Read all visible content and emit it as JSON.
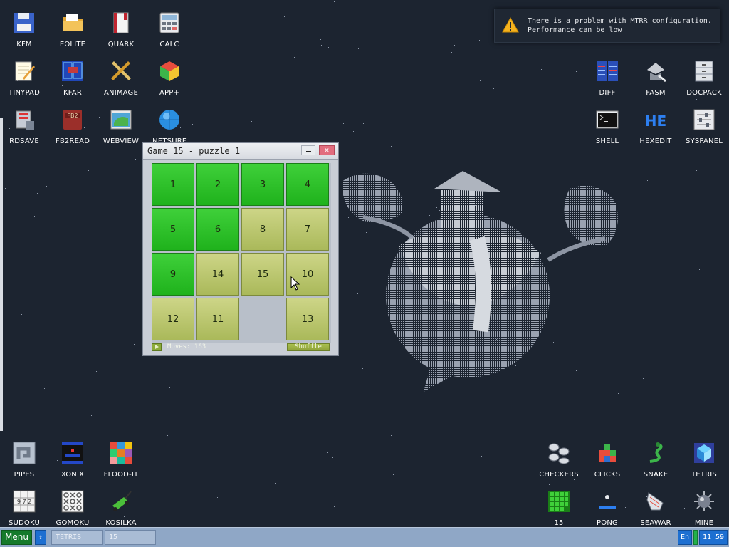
{
  "desktop": {
    "icons_top_left": [
      {
        "label": "KFM",
        "icon": "floppy-disk-icon"
      },
      {
        "label": "EOLITE",
        "icon": "folder-icon"
      },
      {
        "label": "QUARK",
        "icon": "book-icon"
      },
      {
        "label": "CALC",
        "icon": "calculator-icon"
      },
      {
        "label": "TINYPAD",
        "icon": "notepad-icon"
      },
      {
        "label": "KFAR",
        "icon": "panels-icon"
      },
      {
        "label": "ANIMAGE",
        "icon": "pencil-ruler-icon"
      },
      {
        "label": "APP+",
        "icon": "cube-icon"
      },
      {
        "label": "RDSAVE",
        "icon": "disk-save-icon"
      },
      {
        "label": "FB2READ",
        "icon": "fb2-book-icon"
      },
      {
        "label": "WEBVIEW",
        "icon": "web-map-icon"
      },
      {
        "label": "NETSURF",
        "icon": "globe-icon"
      }
    ],
    "icons_top_right": [
      {
        "label": "DIFF",
        "icon": "diff-icon"
      },
      {
        "label": "FASM",
        "icon": "assembler-icon"
      },
      {
        "label": "DOCPACK",
        "icon": "cabinet-icon"
      },
      {
        "label": "SHELL",
        "icon": "terminal-icon"
      },
      {
        "label": "HEXEDIT",
        "icon": "hex-icon"
      },
      {
        "label": "SYSPANEL",
        "icon": "sliders-icon"
      }
    ],
    "icons_bottom_left": [
      {
        "label": "PIPES",
        "icon": "pipes-icon"
      },
      {
        "label": "XONIX",
        "icon": "xonix-icon"
      },
      {
        "label": "FLOOD-IT",
        "icon": "color-grid-icon"
      },
      {
        "label": "SUDOKU",
        "icon": "sudoku-icon"
      },
      {
        "label": "GOMOKU",
        "icon": "tic-tac-toe-icon"
      },
      {
        "label": "KOSILKA",
        "icon": "lawnmower-icon"
      }
    ],
    "icons_bottom_right": [
      {
        "label": "CHECKERS",
        "icon": "checkers-icon"
      },
      {
        "label": "CLICKS",
        "icon": "blocks-icon"
      },
      {
        "label": "SNAKE",
        "icon": "snake-icon"
      },
      {
        "label": "TETRIS",
        "icon": "tetris-icon"
      },
      {
        "label": "15",
        "icon": "fifteen-grid-icon"
      },
      {
        "label": "PONG",
        "icon": "pong-icon"
      },
      {
        "label": "SEAWAR",
        "icon": "ship-icon"
      },
      {
        "label": "MINE",
        "icon": "mine-icon"
      }
    ]
  },
  "notification": {
    "line1": "There is a problem with MTRR configuration.",
    "line2": "Performance can be low",
    "icon": "warning-icon"
  },
  "game_window": {
    "title": "Game 15 - puzzle 1",
    "close_glyph": "×",
    "tiles": [
      {
        "value": "1",
        "state": "placed"
      },
      {
        "value": "2",
        "state": "placed"
      },
      {
        "value": "3",
        "state": "placed"
      },
      {
        "value": "4",
        "state": "placed"
      },
      {
        "value": "5",
        "state": "placed"
      },
      {
        "value": "6",
        "state": "placed"
      },
      {
        "value": "8",
        "state": "misplaced"
      },
      {
        "value": "7",
        "state": "misplaced"
      },
      {
        "value": "9",
        "state": "placed"
      },
      {
        "value": "14",
        "state": "misplaced"
      },
      {
        "value": "15",
        "state": "misplaced"
      },
      {
        "value": "10",
        "state": "misplaced"
      },
      {
        "value": "12",
        "state": "misplaced"
      },
      {
        "value": "11",
        "state": "misplaced"
      },
      {
        "value": "",
        "state": "empty"
      },
      {
        "value": "13",
        "state": "misplaced"
      }
    ],
    "moves_text": "Moves: 163",
    "shuffle_label": "Shuffle"
  },
  "taskbar": {
    "menu_label": "Menu",
    "switch_glyph": "↕",
    "tasks": [
      {
        "label": "TETRIS"
      },
      {
        "label": "15"
      }
    ],
    "language": "En",
    "clock": "11 59"
  },
  "colors": {
    "desktop_bg": "#1c2430",
    "tile_placed": "#2bc028",
    "tile_misplaced": "#bcc76f",
    "taskbar": "#8fa7c6",
    "menu_button": "#157a2b"
  }
}
